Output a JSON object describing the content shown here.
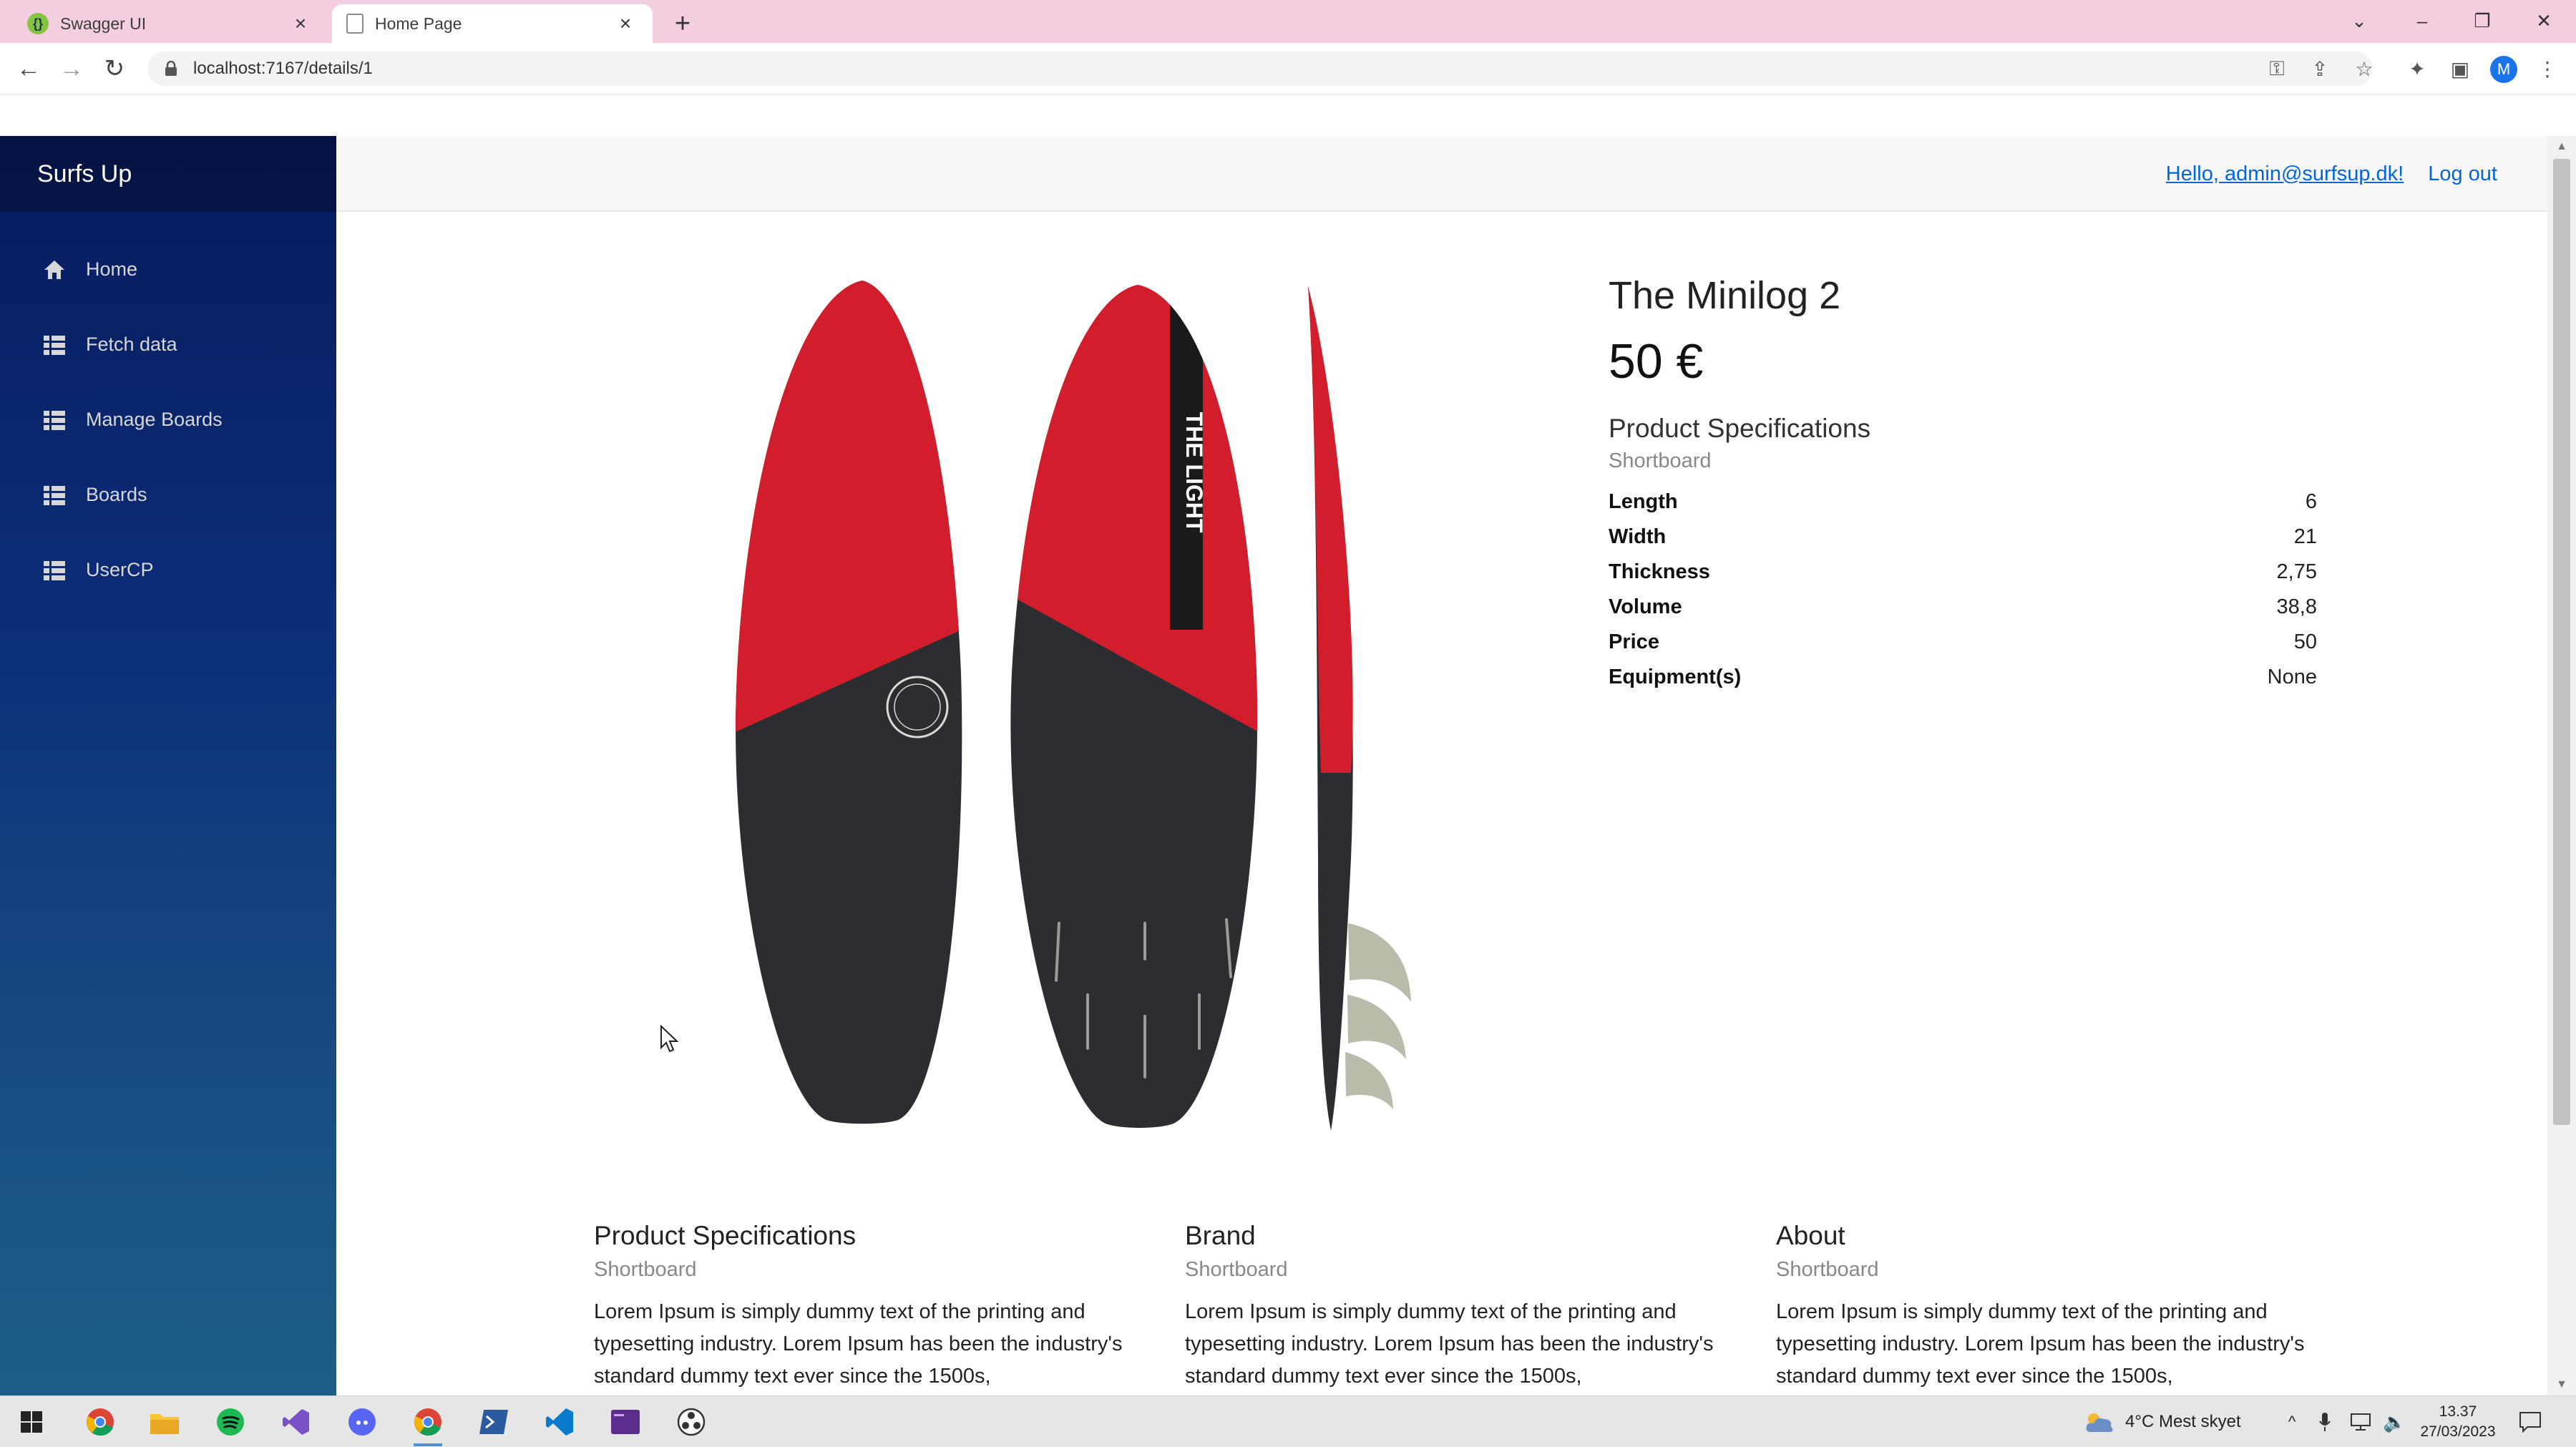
{
  "browser": {
    "tabs": [
      {
        "label": "Swagger UI",
        "active": false
      },
      {
        "label": "Home Page",
        "active": true
      }
    ],
    "url": "localhost:7167/details/1",
    "profile_initial": "M"
  },
  "app": {
    "brand": "Surfs Up",
    "nav": [
      {
        "label": "Home",
        "icon": "home-icon"
      },
      {
        "label": "Fetch data",
        "icon": "list-icon"
      },
      {
        "label": "Manage Boards",
        "icon": "list-icon"
      },
      {
        "label": "Boards",
        "icon": "list-icon"
      },
      {
        "label": "UserCP",
        "icon": "list-icon"
      }
    ],
    "greeting": "Hello, admin@surfsup.dk!",
    "logout": "Log out"
  },
  "product": {
    "name": "The Minilog 2",
    "price": "50 €",
    "spec_heading": "Product Specifications",
    "category": "Shortboard",
    "board_text": "THE LIGHT",
    "specs": [
      {
        "key": "Length",
        "value": "6"
      },
      {
        "key": "Width",
        "value": "21"
      },
      {
        "key": "Thickness",
        "value": "2,75"
      },
      {
        "key": "Volume",
        "value": "38,8"
      },
      {
        "key": "Price",
        "value": "50"
      },
      {
        "key": "Equipment(s)",
        "value": "None"
      }
    ]
  },
  "sections": [
    {
      "title": "Product Specifications",
      "sub": "Shortboard",
      "text": "Lorem Ipsum is simply dummy text of the printing and typesetting industry. Lorem Ipsum has been the industry's standard dummy text ever since the 1500s,"
    },
    {
      "title": "Brand",
      "sub": "Shortboard",
      "text": "Lorem Ipsum is simply dummy text of the printing and typesetting industry. Lorem Ipsum has been the industry's standard dummy text ever since the 1500s,"
    },
    {
      "title": "About",
      "sub": "Shortboard",
      "text": "Lorem Ipsum is simply dummy text of the printing and typesetting industry. Lorem Ipsum has been the industry's standard dummy text ever since the 1500s,"
    }
  ],
  "taskbar": {
    "weather": "4°C  Mest skyet",
    "time": "13.37",
    "date": "27/03/2023"
  },
  "colors": {
    "sidebar_top": "#061a5e",
    "sidebar_bottom": "#1d5e86",
    "link": "#0366d6",
    "board_red": "#d21e2c",
    "board_dark": "#2b2d31",
    "tabstrip": "#f3cee0"
  }
}
